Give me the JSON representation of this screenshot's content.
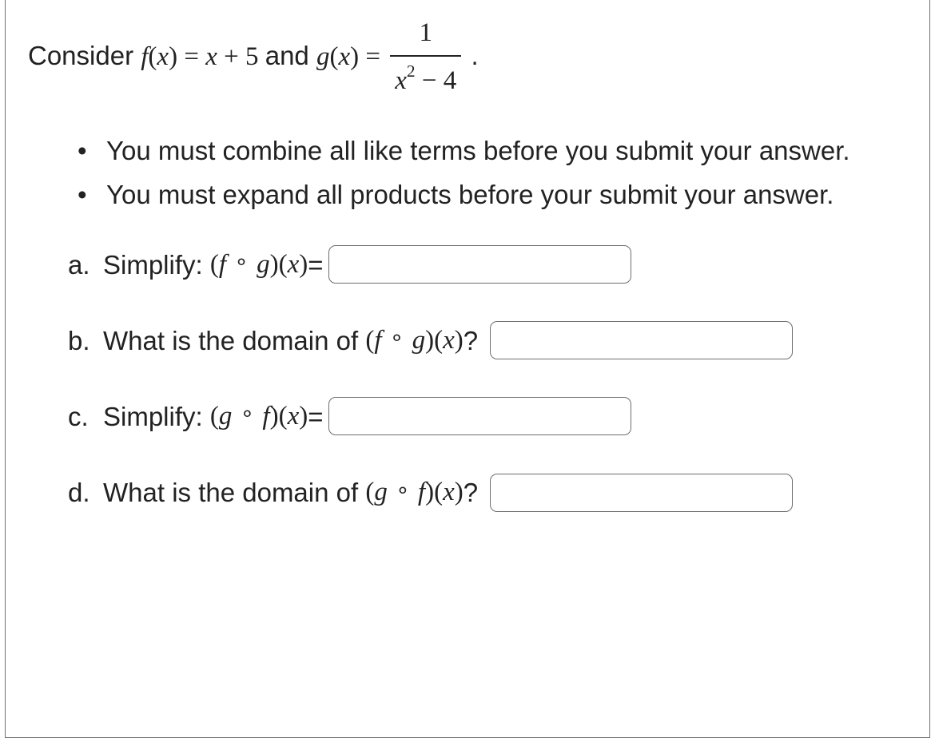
{
  "intro": {
    "lead": "Consider ",
    "f_lhs_f": "f",
    "f_lhs_open": "(",
    "f_lhs_x": "x",
    "f_lhs_close": ")",
    "eq1": " = ",
    "f_rhs_x": "x",
    "f_rhs_plus5": " + 5",
    "and": " and ",
    "g_lhs_g": "g",
    "g_lhs_open": "(",
    "g_lhs_x": "x",
    "g_lhs_close": ")",
    "eq2": " = ",
    "frac_num": "1",
    "frac_den_x": "x",
    "frac_den_exp": "2",
    "frac_den_minus4": " − 4",
    "period": "."
  },
  "instructions": [
    "You must combine all like terms before you submit your answer.",
    "You must expand all products before your submit your answer."
  ],
  "questions": {
    "a": {
      "label": "a.",
      "text": "Simplify: ",
      "expr_open": "(",
      "f": "f",
      "compose": "∘",
      "g": "g",
      "expr_close": ")",
      "arg_open": "(",
      "x": "x",
      "arg_close": ")",
      "tail": " ="
    },
    "b": {
      "label": "b.",
      "text": "What is the domain of ",
      "expr_open": "(",
      "f": "f",
      "compose": "∘",
      "g": "g",
      "expr_close": ")",
      "arg_open": "(",
      "x": "x",
      "arg_close": ")",
      "tail": "?"
    },
    "c": {
      "label": "c.",
      "text": "Simplify: ",
      "expr_open": "(",
      "f": "g",
      "compose": "∘",
      "g": "f",
      "expr_close": ")",
      "arg_open": "(",
      "x": "x",
      "arg_close": ")",
      "tail": " ="
    },
    "d": {
      "label": "d.",
      "text": "What is the domain of ",
      "expr_open": "(",
      "f": "g",
      "compose": "∘",
      "g": "f",
      "expr_close": ")",
      "arg_open": "(",
      "x": "x",
      "arg_close": ")",
      "tail": "?"
    }
  }
}
